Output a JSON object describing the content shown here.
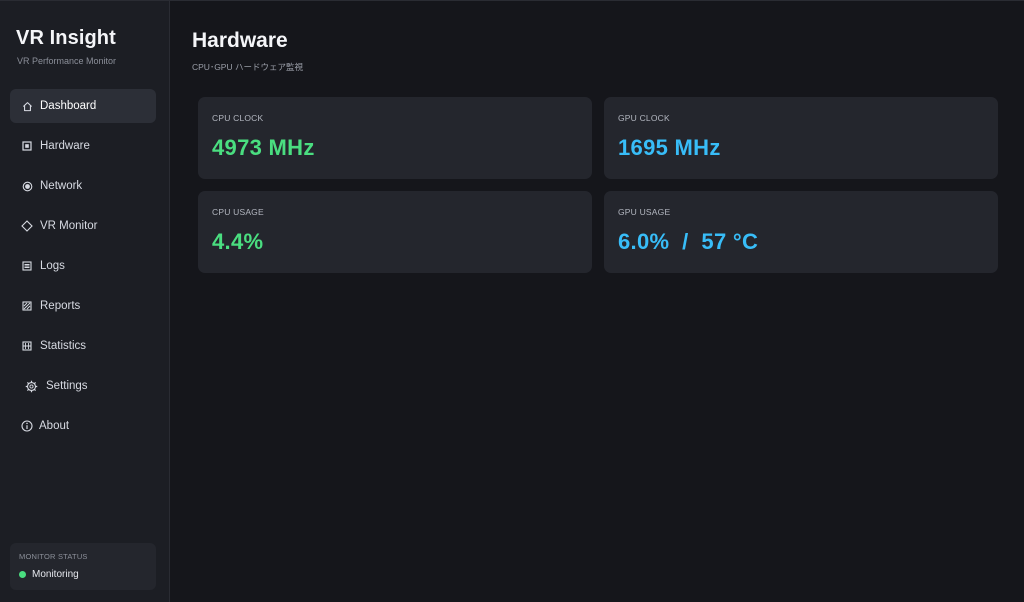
{
  "sidebar": {
    "title": "VR Insight",
    "subtitle": "VR Performance Monitor",
    "items": [
      {
        "label": "Dashboard",
        "icon": "home-icon"
      },
      {
        "label": "Hardware",
        "icon": "chip-icon"
      },
      {
        "label": "Network",
        "icon": "network-icon"
      },
      {
        "label": "VR Monitor",
        "icon": "diamond-icon"
      },
      {
        "label": "Logs",
        "icon": "logs-icon"
      },
      {
        "label": "Reports",
        "icon": "reports-icon"
      },
      {
        "label": "Statistics",
        "icon": "statistics-icon"
      },
      {
        "label": "Settings",
        "icon": "gear-icon"
      },
      {
        "label": "About",
        "icon": "info-icon"
      }
    ],
    "active_item": "Dashboard",
    "status": {
      "label": "MONITOR STATUS",
      "value": "Monitoring",
      "color": "#4ade80"
    }
  },
  "main": {
    "title": "Hardware",
    "subtitle": "CPU･GPU ハードウェア監視",
    "cards": [
      {
        "label": "CPU CLOCK",
        "value": "4973 MHz",
        "color": "#4ade80"
      },
      {
        "label": "GPU CLOCK",
        "value": "1695 MHz",
        "color": "#38bdf8"
      },
      {
        "label": "CPU USAGE",
        "value": "4.4%",
        "color": "#4ade80"
      },
      {
        "label": "GPU USAGE",
        "value": "6.0%  /  57 °C",
        "color": "#38bdf8"
      }
    ]
  },
  "colors": {
    "background": "#15161b",
    "sidebar": "#1c1e24",
    "card": "#24262d",
    "accent_green": "#4ade80",
    "accent_blue": "#38bdf8"
  }
}
